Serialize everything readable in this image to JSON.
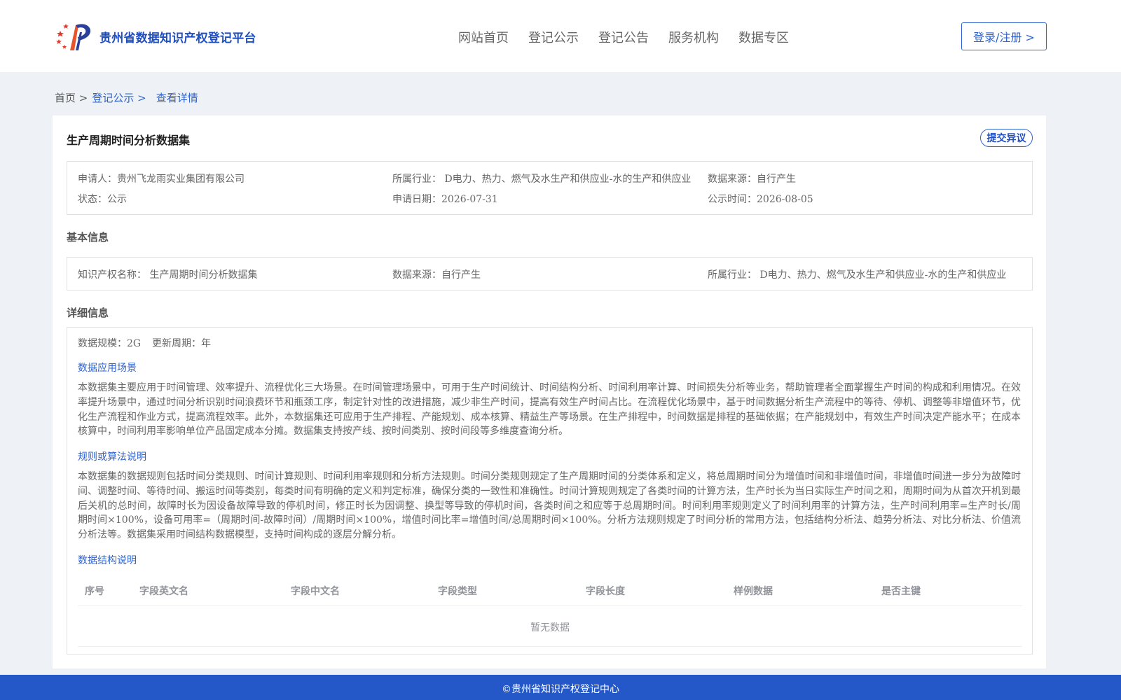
{
  "header": {
    "site_name": "贵州省数据知识产权登记平台",
    "nav": [
      "网站首页",
      "登记公示",
      "登记公告",
      "服务机构",
      "数据专区"
    ],
    "login_label": "登录/注册 >"
  },
  "breadcrumb": {
    "home": "首页 >",
    "section": "登记公示 >",
    "current": "查看详情"
  },
  "record": {
    "title": "生产周期时间分析数据集",
    "objection_label": "提交异议",
    "summary": {
      "applicant": "申请人：贵州飞龙雨实业集团有限公司",
      "industry": "所属行业： D电力、热力、燃气及水生产和供应业-水的生产和供应业",
      "source": "数据来源：自行产生",
      "status": "状态：公示",
      "apply_date": "申请日期：2026-07-31",
      "publish_date": "公示时间：2026-08-05"
    }
  },
  "basic": {
    "heading": "基本信息",
    "ip_name": "知识产权名称： 生产周期时间分析数据集",
    "source": "数据来源：自行产生",
    "industry": "所属行业： D电力、热力、燃气及水生产和供应业-水的生产和供应业"
  },
  "detail": {
    "heading": "详细信息",
    "scale": "数据规模：2G",
    "update_cycle": "更新周期：年",
    "scenario_title": "数据应用场景",
    "scenario_text": "本数据集主要应用于时间管理、效率提升、流程优化三大场景。在时间管理场景中，可用于生产时间统计、时间结构分析、时间利用率计算、时间损失分析等业务，帮助管理者全面掌握生产时间的构成和利用情况。在效率提升场景中，通过时间分析识别时间浪费环节和瓶颈工序，制定针对性的改进措施，减少非生产时间，提高有效生产时间占比。在流程优化场景中，基于时间数据分析生产流程中的等待、停机、调整等非增值环节，优化生产流程和作业方式，提高流程效率。此外，本数据集还可应用于生产排程、产能规划、成本核算、精益生产等场景。在生产排程中，时间数据是排程的基础依据；在产能规划中，有效生产时间决定产能水平；在成本核算中，时间利用率影响单位产品固定成本分摊。数据集支持按产线、按时间类别、按时间段等多维度查询分析。",
    "rules_title": "规则或算法说明",
    "rules_text": "本数据集的数据规则包括时间分类规则、时间计算规则、时间利用率规则和分析方法规则。时间分类规则规定了生产周期时间的分类体系和定义，将总周期时间分为增值时间和非增值时间，非增值时间进一步分为故障时间、调整时间、等待时间、搬运时间等类别，每类时间有明确的定义和判定标准，确保分类的一致性和准确性。时间计算规则规定了各类时间的计算方法，生产时长为当日实际生产时间之和，周期时间为从首次开机到最后关机的总时间，故障时长为因设备故障导致的停机时间，修正时长为因调整、换型等导致的停机时间，各类时间之和应等于总周期时间。时间利用率规则定义了时间利用率的计算方法，生产时间利用率=生产时长/周期时间×100%，设备可用率=（周期时间-故障时间）/周期时间×100%，增值时间比率=增值时间/总周期时间×100%。分析方法规则规定了时间分析的常用方法，包括结构分析法、趋势分析法、对比分析法、价值流分析法等。数据集采用时间结构数据模型，支持时间构成的逐层分解分析。",
    "structure_title": "数据结构说明",
    "table_headers": [
      "序号",
      "字段英文名",
      "字段中文名",
      "字段类型",
      "字段长度",
      "样例数据",
      "是否主键"
    ],
    "empty_text": "暂无数据"
  },
  "footer": {
    "text": "©贵州省知识产权登记中心"
  },
  "colors": {
    "brand_blue": "#2e63cf",
    "footer_blue": "#2458c8",
    "page_bg": "#eef2f6"
  }
}
